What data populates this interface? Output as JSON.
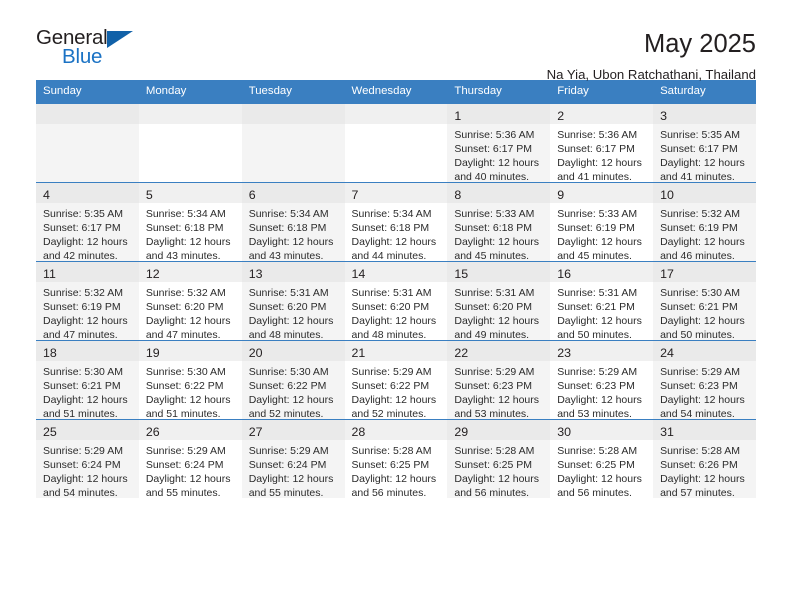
{
  "logo": {
    "word_top": "General",
    "word_bottom": "Blue",
    "triangle_icon": "triangle-icon",
    "brand_color": "#1a72c4",
    "triangle_color": "#1161a8"
  },
  "header": {
    "title": "May 2025",
    "subtitle": "Na Yia, Ubon Ratchathani, Thailand",
    "accent_color": "#3a7fc1"
  },
  "weekday_headers": [
    "Sunday",
    "Monday",
    "Tuesday",
    "Wednesday",
    "Thursday",
    "Friday",
    "Saturday"
  ],
  "labels": {
    "sunrise_prefix": "Sunrise:",
    "sunset_prefix": "Sunset:",
    "daylight_prefix": "Daylight:"
  },
  "weeks": [
    [
      {
        "day": "",
        "lines": []
      },
      {
        "day": "",
        "lines": []
      },
      {
        "day": "",
        "lines": []
      },
      {
        "day": "",
        "lines": []
      },
      {
        "day": "1",
        "lines": [
          "Sunrise: 5:36 AM",
          "Sunset: 6:17 PM",
          "Daylight: 12 hours",
          "and 40 minutes."
        ]
      },
      {
        "day": "2",
        "lines": [
          "Sunrise: 5:36 AM",
          "Sunset: 6:17 PM",
          "Daylight: 12 hours",
          "and 41 minutes."
        ]
      },
      {
        "day": "3",
        "lines": [
          "Sunrise: 5:35 AM",
          "Sunset: 6:17 PM",
          "Daylight: 12 hours",
          "and 41 minutes."
        ]
      }
    ],
    [
      {
        "day": "4",
        "lines": [
          "Sunrise: 5:35 AM",
          "Sunset: 6:17 PM",
          "Daylight: 12 hours",
          "and 42 minutes."
        ]
      },
      {
        "day": "5",
        "lines": [
          "Sunrise: 5:34 AM",
          "Sunset: 6:18 PM",
          "Daylight: 12 hours",
          "and 43 minutes."
        ]
      },
      {
        "day": "6",
        "lines": [
          "Sunrise: 5:34 AM",
          "Sunset: 6:18 PM",
          "Daylight: 12 hours",
          "and 43 minutes."
        ]
      },
      {
        "day": "7",
        "lines": [
          "Sunrise: 5:34 AM",
          "Sunset: 6:18 PM",
          "Daylight: 12 hours",
          "and 44 minutes."
        ]
      },
      {
        "day": "8",
        "lines": [
          "Sunrise: 5:33 AM",
          "Sunset: 6:18 PM",
          "Daylight: 12 hours",
          "and 45 minutes."
        ]
      },
      {
        "day": "9",
        "lines": [
          "Sunrise: 5:33 AM",
          "Sunset: 6:19 PM",
          "Daylight: 12 hours",
          "and 45 minutes."
        ]
      },
      {
        "day": "10",
        "lines": [
          "Sunrise: 5:32 AM",
          "Sunset: 6:19 PM",
          "Daylight: 12 hours",
          "and 46 minutes."
        ]
      }
    ],
    [
      {
        "day": "11",
        "lines": [
          "Sunrise: 5:32 AM",
          "Sunset: 6:19 PM",
          "Daylight: 12 hours",
          "and 47 minutes."
        ]
      },
      {
        "day": "12",
        "lines": [
          "Sunrise: 5:32 AM",
          "Sunset: 6:20 PM",
          "Daylight: 12 hours",
          "and 47 minutes."
        ]
      },
      {
        "day": "13",
        "lines": [
          "Sunrise: 5:31 AM",
          "Sunset: 6:20 PM",
          "Daylight: 12 hours",
          "and 48 minutes."
        ]
      },
      {
        "day": "14",
        "lines": [
          "Sunrise: 5:31 AM",
          "Sunset: 6:20 PM",
          "Daylight: 12 hours",
          "and 48 minutes."
        ]
      },
      {
        "day": "15",
        "lines": [
          "Sunrise: 5:31 AM",
          "Sunset: 6:20 PM",
          "Daylight: 12 hours",
          "and 49 minutes."
        ]
      },
      {
        "day": "16",
        "lines": [
          "Sunrise: 5:31 AM",
          "Sunset: 6:21 PM",
          "Daylight: 12 hours",
          "and 50 minutes."
        ]
      },
      {
        "day": "17",
        "lines": [
          "Sunrise: 5:30 AM",
          "Sunset: 6:21 PM",
          "Daylight: 12 hours",
          "and 50 minutes."
        ]
      }
    ],
    [
      {
        "day": "18",
        "lines": [
          "Sunrise: 5:30 AM",
          "Sunset: 6:21 PM",
          "Daylight: 12 hours",
          "and 51 minutes."
        ]
      },
      {
        "day": "19",
        "lines": [
          "Sunrise: 5:30 AM",
          "Sunset: 6:22 PM",
          "Daylight: 12 hours",
          "and 51 minutes."
        ]
      },
      {
        "day": "20",
        "lines": [
          "Sunrise: 5:30 AM",
          "Sunset: 6:22 PM",
          "Daylight: 12 hours",
          "and 52 minutes."
        ]
      },
      {
        "day": "21",
        "lines": [
          "Sunrise: 5:29 AM",
          "Sunset: 6:22 PM",
          "Daylight: 12 hours",
          "and 52 minutes."
        ]
      },
      {
        "day": "22",
        "lines": [
          "Sunrise: 5:29 AM",
          "Sunset: 6:23 PM",
          "Daylight: 12 hours",
          "and 53 minutes."
        ]
      },
      {
        "day": "23",
        "lines": [
          "Sunrise: 5:29 AM",
          "Sunset: 6:23 PM",
          "Daylight: 12 hours",
          "and 53 minutes."
        ]
      },
      {
        "day": "24",
        "lines": [
          "Sunrise: 5:29 AM",
          "Sunset: 6:23 PM",
          "Daylight: 12 hours",
          "and 54 minutes."
        ]
      }
    ],
    [
      {
        "day": "25",
        "lines": [
          "Sunrise: 5:29 AM",
          "Sunset: 6:24 PM",
          "Daylight: 12 hours",
          "and 54 minutes."
        ]
      },
      {
        "day": "26",
        "lines": [
          "Sunrise: 5:29 AM",
          "Sunset: 6:24 PM",
          "Daylight: 12 hours",
          "and 55 minutes."
        ]
      },
      {
        "day": "27",
        "lines": [
          "Sunrise: 5:29 AM",
          "Sunset: 6:24 PM",
          "Daylight: 12 hours",
          "and 55 minutes."
        ]
      },
      {
        "day": "28",
        "lines": [
          "Sunrise: 5:28 AM",
          "Sunset: 6:25 PM",
          "Daylight: 12 hours",
          "and 56 minutes."
        ]
      },
      {
        "day": "29",
        "lines": [
          "Sunrise: 5:28 AM",
          "Sunset: 6:25 PM",
          "Daylight: 12 hours",
          "and 56 minutes."
        ]
      },
      {
        "day": "30",
        "lines": [
          "Sunrise: 5:28 AM",
          "Sunset: 6:25 PM",
          "Daylight: 12 hours",
          "and 56 minutes."
        ]
      },
      {
        "day": "31",
        "lines": [
          "Sunrise: 5:28 AM",
          "Sunset: 6:26 PM",
          "Daylight: 12 hours",
          "and 57 minutes."
        ]
      }
    ]
  ]
}
